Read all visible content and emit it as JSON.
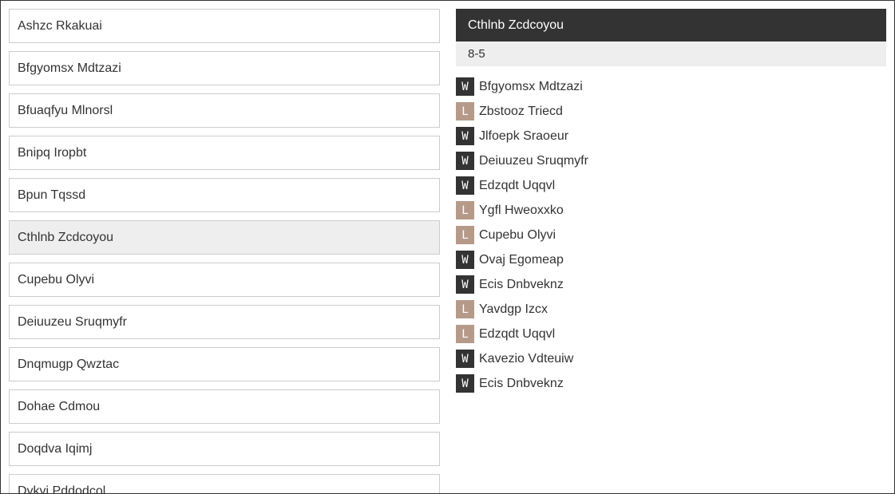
{
  "teams": [
    {
      "name": "Ashzc Rkakuai",
      "selected": false
    },
    {
      "name": "Bfgyomsx Mdtzazi",
      "selected": false
    },
    {
      "name": "Bfuaqfyu Mlnorsl",
      "selected": false
    },
    {
      "name": "Bnipq Iropbt",
      "selected": false
    },
    {
      "name": "Bpun Tqssd",
      "selected": false
    },
    {
      "name": "Cthlnb Zcdcoyou",
      "selected": true
    },
    {
      "name": "Cupebu Olyvi",
      "selected": false
    },
    {
      "name": "Deiuuzeu Sruqmyfr",
      "selected": false
    },
    {
      "name": "Dnqmugp Qwztac",
      "selected": false
    },
    {
      "name": "Dohae Cdmou",
      "selected": false
    },
    {
      "name": "Doqdva Iqimj",
      "selected": false
    },
    {
      "name": "Dykyi Pddodcol",
      "selected": false
    }
  ],
  "detail": {
    "title": "Cthlnb Zcdcoyou",
    "record": "8-5",
    "games": [
      {
        "result": "W",
        "opponent": "Bfgyomsx Mdtzazi"
      },
      {
        "result": "L",
        "opponent": "Zbstooz Triecd"
      },
      {
        "result": "W",
        "opponent": "Jlfoepk Sraoeur"
      },
      {
        "result": "W",
        "opponent": "Deiuuzeu Sruqmyfr"
      },
      {
        "result": "W",
        "opponent": "Edzqdt Uqqvl"
      },
      {
        "result": "L",
        "opponent": "Ygfl Hweoxxko"
      },
      {
        "result": "L",
        "opponent": "Cupebu Olyvi"
      },
      {
        "result": "W",
        "opponent": "Ovaj Egomeap"
      },
      {
        "result": "W",
        "opponent": "Ecis Dnbveknz"
      },
      {
        "result": "L",
        "opponent": "Yavdgp Izcx"
      },
      {
        "result": "L",
        "opponent": "Edzqdt Uqqvl"
      },
      {
        "result": "W",
        "opponent": "Kavezio Vdteuiw"
      },
      {
        "result": "W",
        "opponent": "Ecis Dnbveknz"
      }
    ]
  },
  "colors": {
    "win": "#333333",
    "loss": "#b69a89",
    "header_bg": "#333333",
    "selected_bg": "#eeeeee"
  }
}
